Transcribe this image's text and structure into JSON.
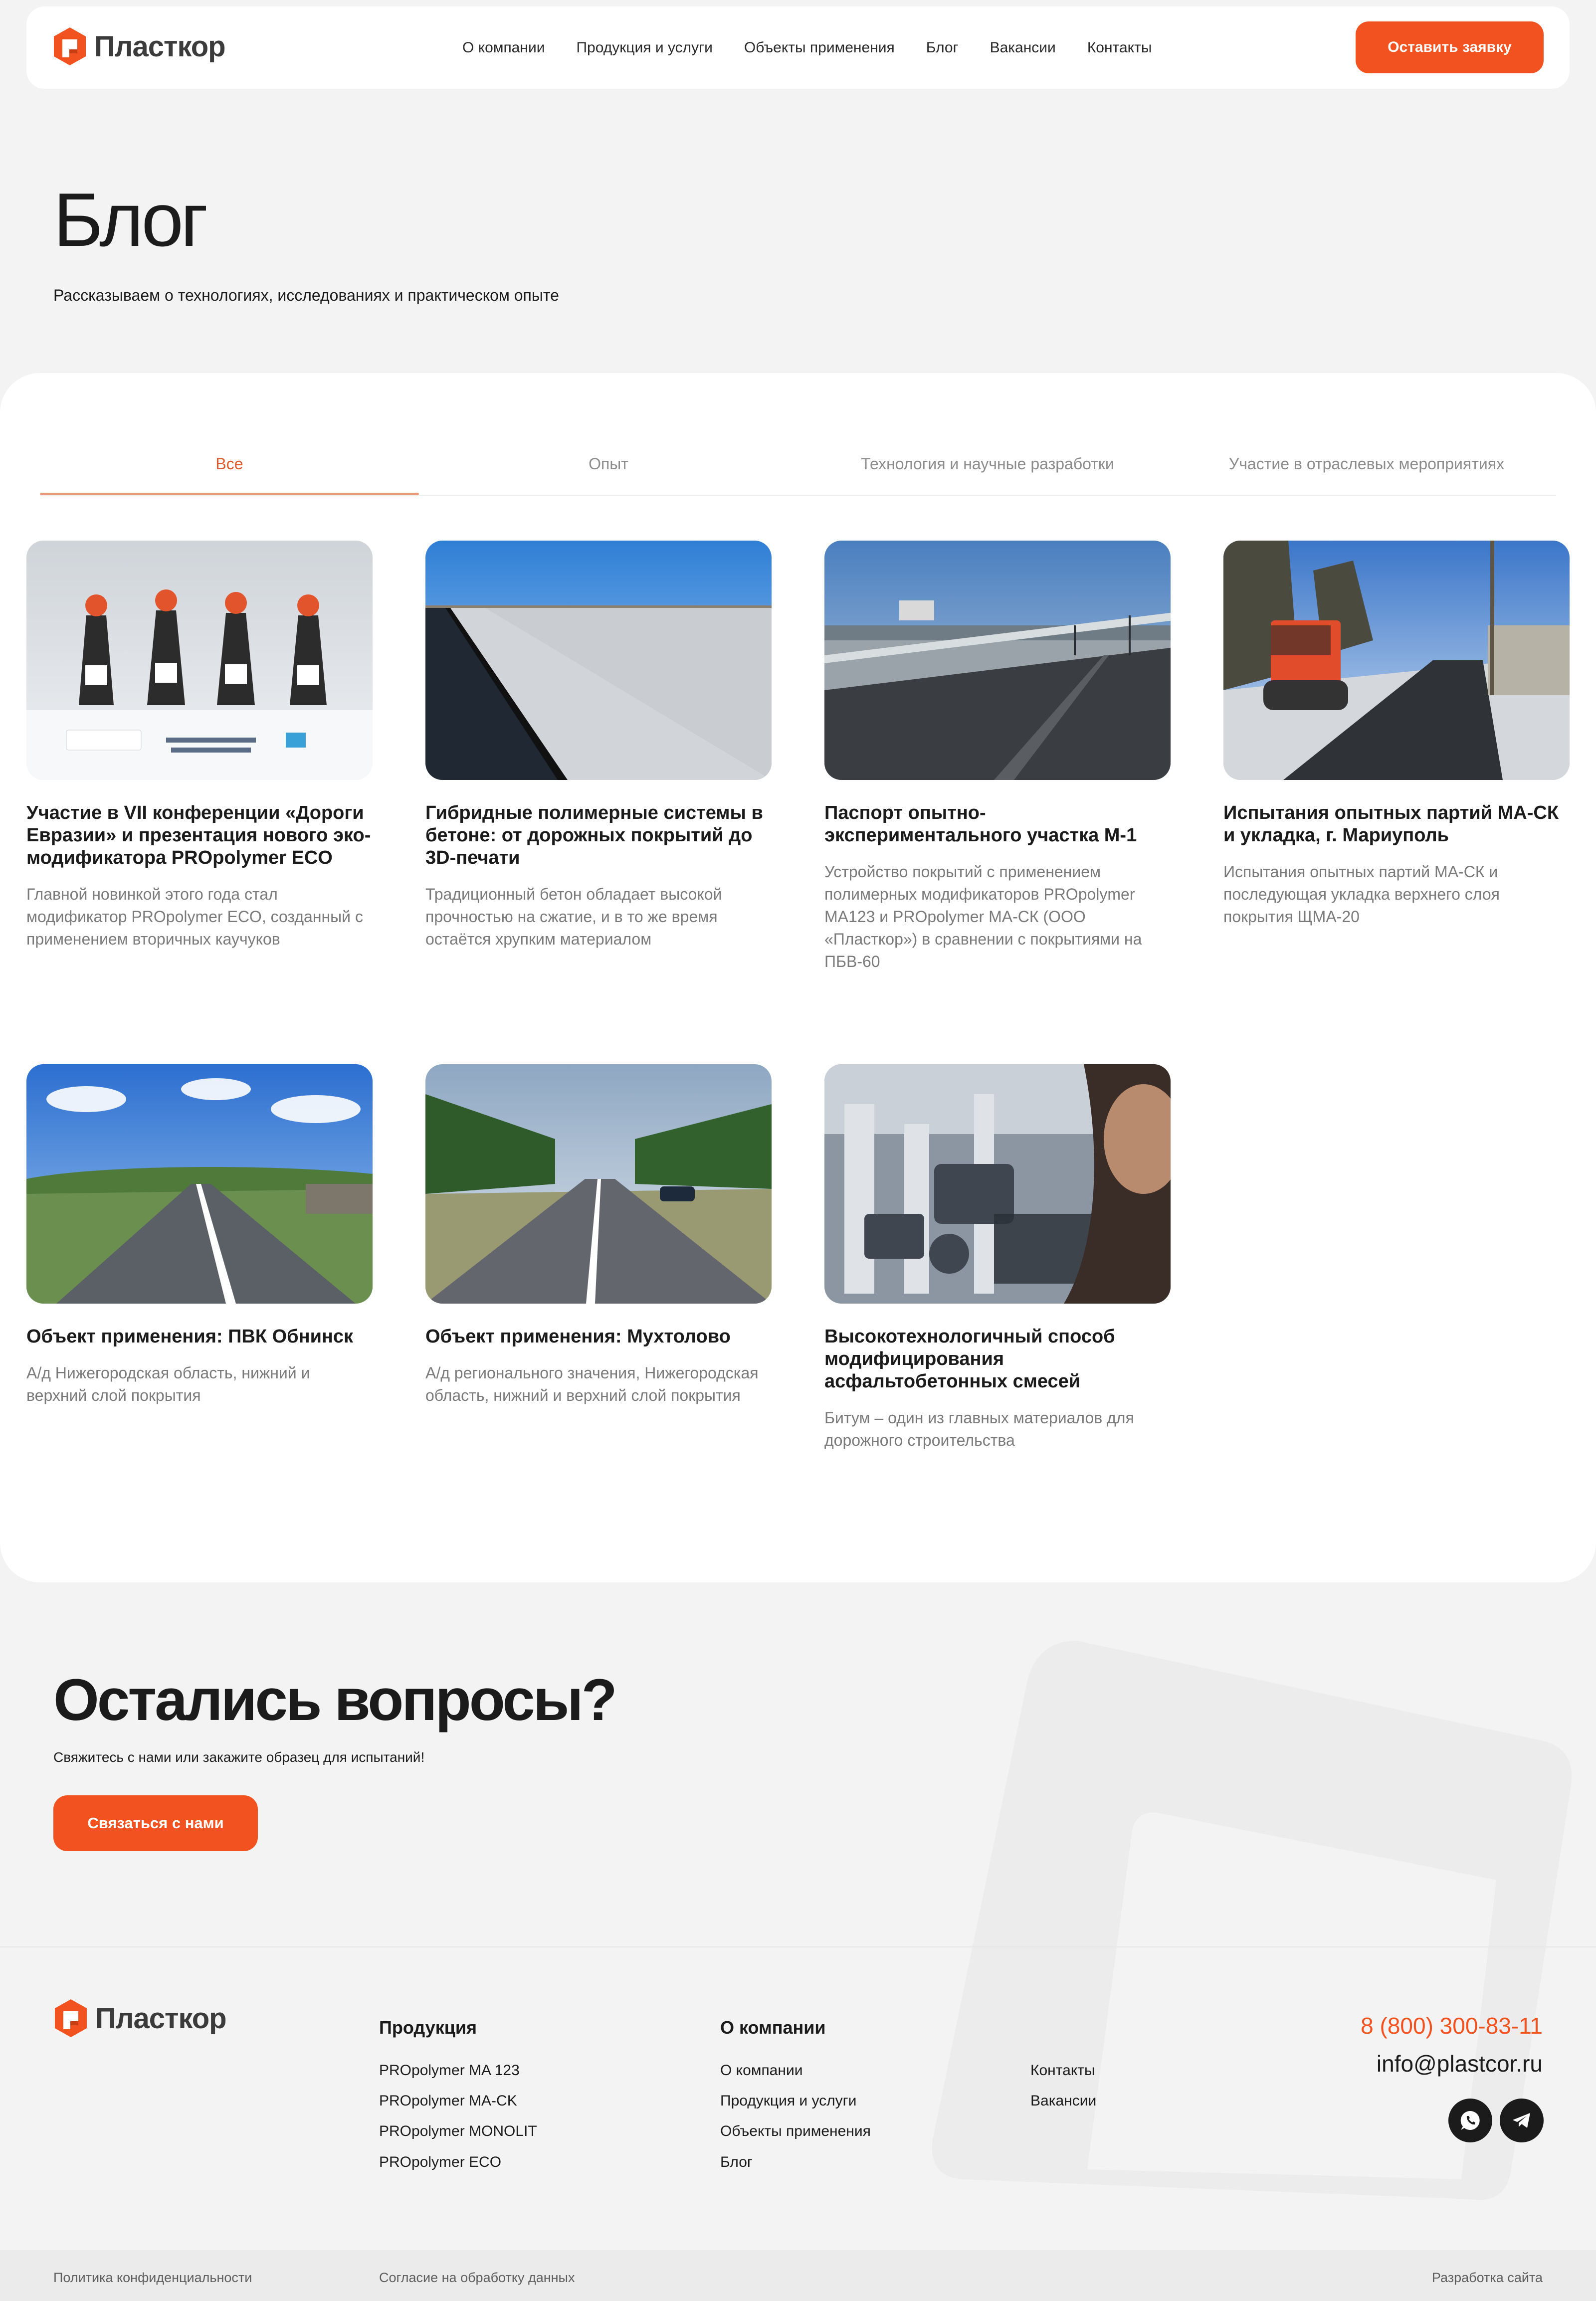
{
  "brand": {
    "name": "Пласткор",
    "accent": "#f2521f"
  },
  "header": {
    "nav": [
      "О компании",
      "Продукция и услуги",
      "Объекты применения",
      "Блог",
      "Вакансии",
      "Контакты"
    ],
    "cta": "Оставить заявку"
  },
  "hero": {
    "title": "Блог",
    "subtitle": "Рассказываем о технологиях, исследованиях и практическом опыте"
  },
  "tabs": [
    {
      "label": "Все",
      "active": true
    },
    {
      "label": "Опыт",
      "active": false
    },
    {
      "label": "Технология и научные разработки",
      "active": false
    },
    {
      "label": "Участие в отраслевых мероприятиях",
      "active": false
    }
  ],
  "posts": [
    {
      "title": "Участие в VII конференции «Дороги Евразии» и презентация нового эко-модификатора PROpolymer ECO",
      "excerpt": "Главной новинкой этого года стал модификатор PROpolymer ECO, созданный с применением вторичных каучуков"
    },
    {
      "title": "Гибридные полимерные системы в бетоне: от дорожных покрытий до 3D-печати",
      "excerpt": "Традиционный бетон обладает высокой прочностью на сжатие, и в то же время остаётся хрупким материалом"
    },
    {
      "title": "Паспорт опытно-экспериментального участка М-1",
      "excerpt": "Устройство покрытий с применением полимерных модификаторов PROpolymer МА123 и PROpolymer МА-СК (ООО «Пласткор») в сравнении с покрытиями на ПБВ-60"
    },
    {
      "title": "Испытания опытных партий МА-СК и укладка, г. Мариуполь",
      "excerpt": "Испытания опытных партий МА-СК и последующая укладка верхнего слоя покрытия ЩМА-20"
    },
    {
      "title": "Объект применения: ПВК Обнинск",
      "excerpt": "А/д Нижегородская область, нижний и верхний слой покрытия"
    },
    {
      "title": "Объект применения: Мухтолово",
      "excerpt": "А/д регионального значения, Нижегородская область, нижний и верхний слой покрытия"
    },
    {
      "title": "Высокотехнологичный способ модифицирования асфальтобетонных смесей",
      "excerpt": "Битум – один из главных материалов для дорожного строительства"
    }
  ],
  "cta": {
    "title": "Остались вопросы?",
    "subtitle": "Свяжитесь с нами или закажите образец для испытаний!",
    "button": "Связаться с нами"
  },
  "footer": {
    "products_heading": "Продукция",
    "products": [
      "PROpolymer MA 123",
      "PROpolymer MA-CK",
      "PROpolymer MONOLIT",
      "PROpolymer ECO"
    ],
    "company_heading": "О компании",
    "company_links": [
      "О компании",
      "Продукция и услуги",
      "Объекты применения",
      "Блог"
    ],
    "extra_links": [
      "Контакты",
      "Вакансии"
    ],
    "phone": "8 (800) 300-83-11",
    "email": "info@plastcor.ru",
    "bottom": {
      "privacy": "Политика конфиденциальности",
      "consent": "Согласие на обработку данных",
      "dev": "Разработка сайта"
    }
  }
}
